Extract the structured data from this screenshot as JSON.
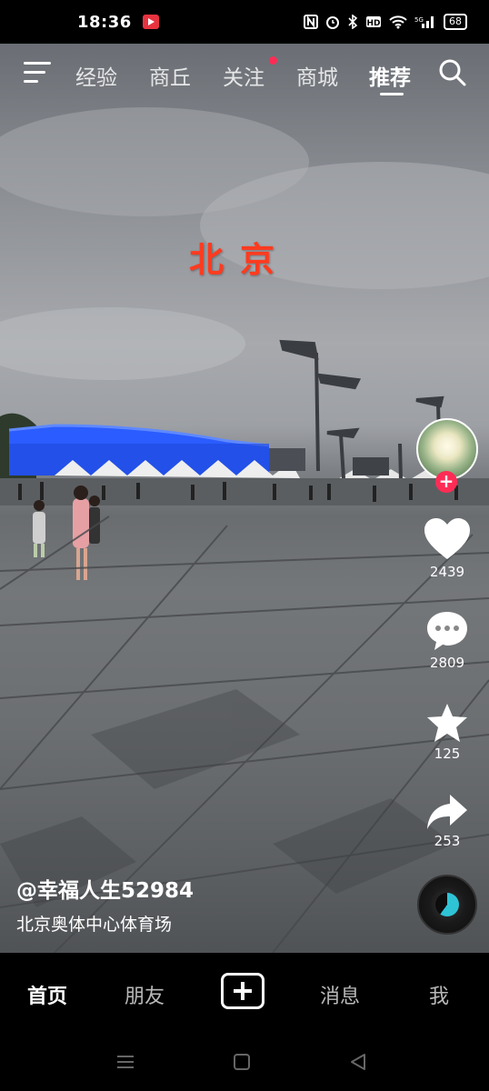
{
  "status_bar": {
    "time": "18:36",
    "battery": "68",
    "icons": [
      "nfc-icon",
      "alarm-icon",
      "bluetooth-icon",
      "hd-icon",
      "wifi-icon",
      "signal-5g-icon"
    ]
  },
  "top_nav": {
    "tabs": [
      {
        "label": "经验"
      },
      {
        "label": "商丘"
      },
      {
        "label": "关注"
      },
      {
        "label": "商城"
      },
      {
        "label": "推荐"
      }
    ],
    "active_tab": "推荐"
  },
  "video": {
    "overlay_text": "北京"
  },
  "actions": {
    "likes": "2439",
    "comments": "2809",
    "favorites": "125",
    "shares": "253"
  },
  "post": {
    "author": "@幸福人生52984",
    "description": "北京奥体中心体育场"
  },
  "bottom_nav": {
    "items": [
      {
        "label": "首页"
      },
      {
        "label": "朋友"
      },
      {
        "label": "消息"
      },
      {
        "label": "我"
      }
    ]
  },
  "colors": {
    "accent": "#fe2c55",
    "overlay_text": "#ff3b1f",
    "stadium_blue": "#2a5cff"
  }
}
